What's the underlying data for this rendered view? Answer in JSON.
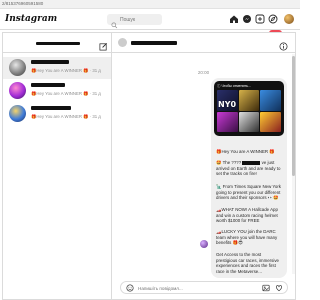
{
  "browser": {
    "url_text": "2/815376960591580"
  },
  "app": {
    "logo": "Instagram"
  },
  "search": {
    "placeholder": "Пошук",
    "icon": "search-icon"
  },
  "nav_icons": [
    "home-icon",
    "messenger-icon",
    "new-post-icon",
    "explore-icon",
    "heart-icon"
  ],
  "notification": {
    "count": "1",
    "color": "#ed4956"
  },
  "threads": [
    {
      "preview": "🎁Hey You are A WINNER 🎁 · 31 д"
    },
    {
      "preview": "🎁Hey You are A WINNER 🎁 · 31 д"
    },
    {
      "preview": "🎁Hey You are A WINNER 🎁 · 31 д"
    }
  ],
  "conversation": {
    "timestamp": "20:00",
    "card_header": "ⓘ Чтобы отменить...",
    "card_title": "NY0",
    "messages": [
      {
        "text": "🎁Hey You are A WINNER 🎁"
      },
      {
        "pre": "🤩 The ????",
        "post": "ve just arrived on Earth and are ready to set the tracks on fire!"
      },
      {
        "text": "🗽 From Times Square New York going to present you our different drivers and their sponsors 👀🤩"
      },
      {
        "text": "🏎️WHAT NOW! A Hallcade App and win a custom racing helmet worth $1000 for FREE"
      },
      {
        "text": "🏎️LUCKY YOU join the DARC team where you will have many benefits 🎁😎"
      },
      {
        "text": "Get Access to the most prestigious car races, immersive experiences and races the first race in the Metaverse..."
      }
    ]
  },
  "composer": {
    "placeholder": "Напишіть повідомл..."
  },
  "colors": {
    "accent": "#0095f6",
    "badge": "#ed4956",
    "bubble": "#efefef",
    "border": "#dbdbdb"
  }
}
